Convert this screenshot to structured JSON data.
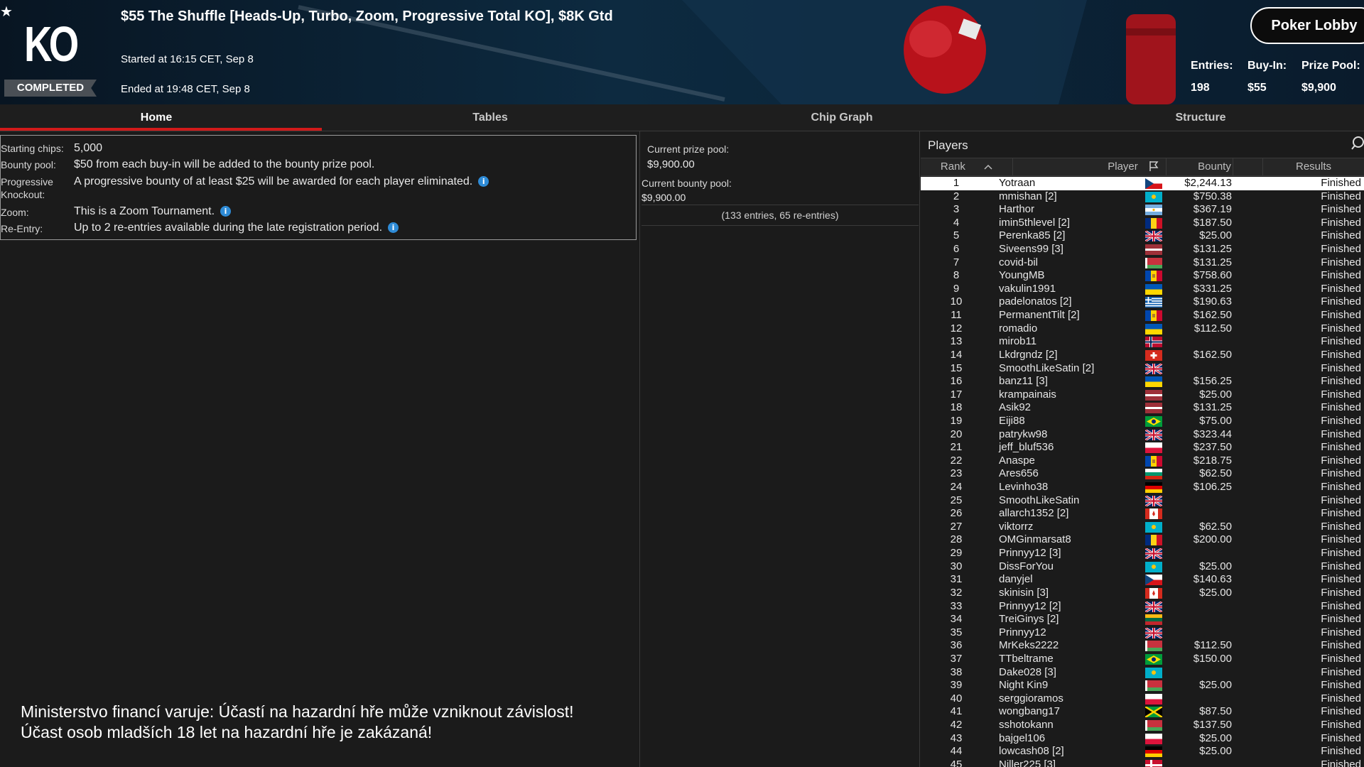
{
  "header": {
    "logo": "KO",
    "status_badge": "COMPLETED",
    "title": "$55 The Shuffle [Heads-Up, Turbo, Zoom, Progressive Total KO], $8K Gtd",
    "started": "Started at 16:15 CET, Sep 8",
    "ended": "Ended at 19:48 CET, Sep 8",
    "lobby_button": "Poker Lobby",
    "stats": [
      {
        "label": "Entries:",
        "value": "198"
      },
      {
        "label": "Buy-In:",
        "value": "$55"
      },
      {
        "label": "Prize Pool:",
        "value": "$9,900"
      }
    ]
  },
  "tabs": [
    "Home",
    "Tables",
    "Chip Graph",
    "Structure"
  ],
  "active_tab": "Home",
  "info": {
    "starting_chips_label": "Starting chips:",
    "starting_chips": "5,000",
    "bounty_pool_label": "Bounty pool:",
    "bounty_pool": "$50 from each buy-in will be added to the bounty prize pool.",
    "progressive_label_1": "Progressive",
    "progressive_label_2": "Knockout:",
    "progressive": "A progressive bounty of at least $25 will be awarded for each player eliminated.",
    "zoom_label": "Zoom:",
    "zoom": "This is a Zoom Tournament.",
    "reentry_label": "Re-Entry:",
    "reentry": "Up to 2 re-entries available during the late registration period."
  },
  "prize": {
    "current_prize_label": "Current prize pool:",
    "current_prize": "$9,900.00",
    "current_bounty_label": "Current bounty pool:",
    "current_bounty": "$9,900.00",
    "entries_note": "(133 entries, 65 re-entries)"
  },
  "warning": {
    "line1": "Ministerstvo financí varuje: Účastí na hazardní hře může vzniknout závislost!",
    "line2": "Účast osob mladších 18 let na hazardní hře je zakázaná!"
  },
  "players": {
    "title": "Players",
    "columns": {
      "rank": "Rank",
      "player": "Player",
      "bounty": "Bounty",
      "results": "Results"
    },
    "sort_icon": "chevron-up-icon",
    "flag_header_icon": "flag-icon",
    "rows": [
      {
        "rank": "1",
        "player": "Yotraan",
        "flag": "cz",
        "bounty": "$2,244.13",
        "result": "Finished"
      },
      {
        "rank": "2",
        "player": "mmishan [2]",
        "flag": "kz",
        "bounty": "$750.38",
        "result": "Finished"
      },
      {
        "rank": "3",
        "player": "Harthor",
        "flag": "ar",
        "bounty": "$367.19",
        "result": "Finished"
      },
      {
        "rank": "4",
        "player": "imin5thlevel [2]",
        "flag": "ro",
        "bounty": "$187.50",
        "result": "Finished"
      },
      {
        "rank": "5",
        "player": "Perenka85 [2]",
        "flag": "gb",
        "bounty": "$25.00",
        "result": "Finished"
      },
      {
        "rank": "6",
        "player": "Siveens99 [3]",
        "flag": "lv",
        "bounty": "$131.25",
        "result": "Finished"
      },
      {
        "rank": "7",
        "player": "covid-bil",
        "flag": "by",
        "bounty": "$131.25",
        "result": "Finished"
      },
      {
        "rank": "8",
        "player": "YoungMB",
        "flag": "md",
        "bounty": "$758.60",
        "result": "Finished"
      },
      {
        "rank": "9",
        "player": "vakulin1991",
        "flag": "ua",
        "bounty": "$331.25",
        "result": "Finished"
      },
      {
        "rank": "10",
        "player": "padelonatos [2]",
        "flag": "gr",
        "bounty": "$190.63",
        "result": "Finished"
      },
      {
        "rank": "11",
        "player": "PermanentTilt [2]",
        "flag": "md",
        "bounty": "$162.50",
        "result": "Finished"
      },
      {
        "rank": "12",
        "player": "romadio",
        "flag": "ua",
        "bounty": "$112.50",
        "result": "Finished"
      },
      {
        "rank": "13",
        "player": "mirob11",
        "flag": "no",
        "bounty": "",
        "result": "Finished"
      },
      {
        "rank": "14",
        "player": "Lkdrgndz [2]",
        "flag": "ch",
        "bounty": "$162.50",
        "result": "Finished"
      },
      {
        "rank": "15",
        "player": "SmoothLikeSatin [2]",
        "flag": "gb",
        "bounty": "",
        "result": "Finished"
      },
      {
        "rank": "16",
        "player": "banz11 [3]",
        "flag": "ua",
        "bounty": "$156.25",
        "result": "Finished"
      },
      {
        "rank": "17",
        "player": "krampainais",
        "flag": "lv",
        "bounty": "$25.00",
        "result": "Finished"
      },
      {
        "rank": "18",
        "player": "Asik92",
        "flag": "lv",
        "bounty": "$131.25",
        "result": "Finished"
      },
      {
        "rank": "19",
        "player": "Eiji88",
        "flag": "br",
        "bounty": "$75.00",
        "result": "Finished"
      },
      {
        "rank": "20",
        "player": "patrykw98",
        "flag": "gb",
        "bounty": "$323.44",
        "result": "Finished"
      },
      {
        "rank": "21",
        "player": "jeff_bluf536",
        "flag": "pl",
        "bounty": "$237.50",
        "result": "Finished"
      },
      {
        "rank": "22",
        "player": "Anaspe",
        "flag": "md",
        "bounty": "$218.75",
        "result": "Finished"
      },
      {
        "rank": "23",
        "player": "Ares656",
        "flag": "bg",
        "bounty": "$62.50",
        "result": "Finished"
      },
      {
        "rank": "24",
        "player": "Levinho38",
        "flag": "de",
        "bounty": "$106.25",
        "result": "Finished"
      },
      {
        "rank": "25",
        "player": "SmoothLikeSatin",
        "flag": "gb",
        "bounty": "",
        "result": "Finished"
      },
      {
        "rank": "26",
        "player": "allarch1352 [2]",
        "flag": "ca",
        "bounty": "",
        "result": "Finished"
      },
      {
        "rank": "27",
        "player": "viktorrz",
        "flag": "kz",
        "bounty": "$62.50",
        "result": "Finished"
      },
      {
        "rank": "28",
        "player": "OMGinmarsat8",
        "flag": "ro",
        "bounty": "$200.00",
        "result": "Finished"
      },
      {
        "rank": "29",
        "player": "Prinnyy12 [3]",
        "flag": "gb",
        "bounty": "",
        "result": "Finished"
      },
      {
        "rank": "30",
        "player": "DissForYou",
        "flag": "kz",
        "bounty": "$25.00",
        "result": "Finished"
      },
      {
        "rank": "31",
        "player": "danyjel",
        "flag": "cz",
        "bounty": "$140.63",
        "result": "Finished"
      },
      {
        "rank": "32",
        "player": "skinisin [3]",
        "flag": "ca",
        "bounty": "$25.00",
        "result": "Finished"
      },
      {
        "rank": "33",
        "player": "Prinnyy12 [2]",
        "flag": "gb",
        "bounty": "",
        "result": "Finished"
      },
      {
        "rank": "34",
        "player": "TreiGinys [2]",
        "flag": "lt",
        "bounty": "",
        "result": "Finished"
      },
      {
        "rank": "35",
        "player": "Prinnyy12",
        "flag": "gb",
        "bounty": "",
        "result": "Finished"
      },
      {
        "rank": "36",
        "player": "MrKeks2222",
        "flag": "by",
        "bounty": "$112.50",
        "result": "Finished"
      },
      {
        "rank": "37",
        "player": "TTbeltrame",
        "flag": "br",
        "bounty": "$150.00",
        "result": "Finished"
      },
      {
        "rank": "38",
        "player": "Dake028 [3]",
        "flag": "kz",
        "bounty": "",
        "result": "Finished"
      },
      {
        "rank": "39",
        "player": "Night Kin9",
        "flag": "by",
        "bounty": "$25.00",
        "result": "Finished"
      },
      {
        "rank": "40",
        "player": "serggioramos",
        "flag": "pl",
        "bounty": "",
        "result": "Finished"
      },
      {
        "rank": "41",
        "player": "wongbang17",
        "flag": "jm",
        "bounty": "$87.50",
        "result": "Finished"
      },
      {
        "rank": "42",
        "player": "sshotokann",
        "flag": "by",
        "bounty": "$137.50",
        "result": "Finished"
      },
      {
        "rank": "43",
        "player": "bajgel106",
        "flag": "pl",
        "bounty": "$25.00",
        "result": "Finished"
      },
      {
        "rank": "44",
        "player": "lowcash08 [2]",
        "flag": "de",
        "bounty": "$25.00",
        "result": "Finished"
      },
      {
        "rank": "45",
        "player": "Niller225 [3]",
        "flag": "dk",
        "bounty": "",
        "result": "Finished"
      }
    ]
  },
  "colors": {
    "accent_red": "#d11a1a",
    "info_blue": "#2e8bd6",
    "panel_bg": "#1b1b1b"
  }
}
